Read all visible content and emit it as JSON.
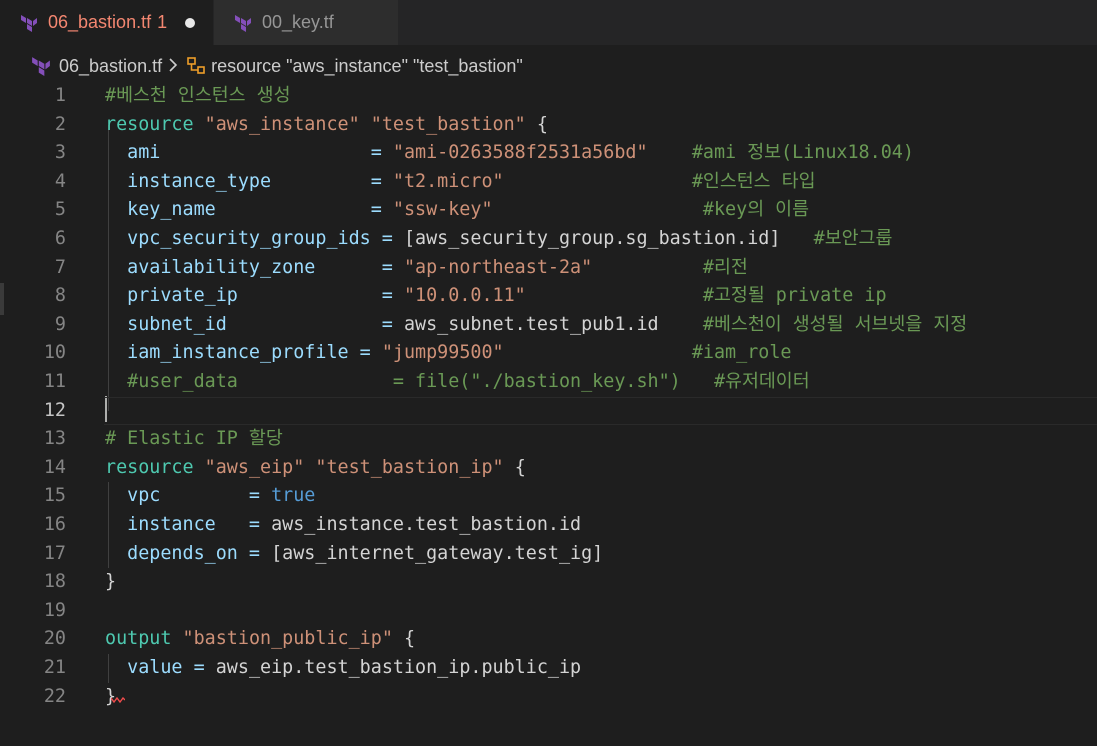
{
  "tabs": [
    {
      "label": "06_bastion.tf",
      "badge": "1",
      "modified": true,
      "active": true
    },
    {
      "label": "00_key.tf",
      "active": false
    }
  ],
  "breadcrumb": {
    "file": "06_bastion.tf",
    "symbol": "resource \"aws_instance\" \"test_bastion\""
  },
  "colors": {
    "accent_terraform": "#844fba",
    "active_tab_text": "#f48771",
    "symbol_icon": "#ee9d28"
  },
  "editor": {
    "current_line": 12,
    "lines": [
      {
        "n": "1",
        "parts": [
          {
            "t": "#베스천 인스턴스 생성",
            "c": "com"
          }
        ]
      },
      {
        "n": "2",
        "parts": [
          {
            "t": "resource ",
            "c": "res"
          },
          {
            "t": "\"aws_instance\"",
            "c": "str"
          },
          {
            "t": " ",
            "c": "plain"
          },
          {
            "t": "\"test_bastion\"",
            "c": "str"
          },
          {
            "t": " {",
            "c": "plain"
          }
        ]
      },
      {
        "n": "3",
        "parts": [
          {
            "t": "  ami                   = ",
            "c": "var"
          },
          {
            "t": "\"ami-0263588f2531a56bd\"",
            "c": "str"
          },
          {
            "t": "    ",
            "c": "plain"
          },
          {
            "t": "#ami 정보(Linux18.04)",
            "c": "com"
          }
        ]
      },
      {
        "n": "4",
        "parts": [
          {
            "t": "  instance_type         = ",
            "c": "var"
          },
          {
            "t": "\"t2.micro\"",
            "c": "str"
          },
          {
            "t": "                 ",
            "c": "plain"
          },
          {
            "t": "#인스턴스 타입",
            "c": "com"
          }
        ]
      },
      {
        "n": "5",
        "parts": [
          {
            "t": "  key_name              = ",
            "c": "var"
          },
          {
            "t": "\"ssw-key\"",
            "c": "str"
          },
          {
            "t": "                   ",
            "c": "plain"
          },
          {
            "t": "#key의 이름",
            "c": "com"
          }
        ]
      },
      {
        "n": "6",
        "parts": [
          {
            "t": "  vpc_security_group_ids = ",
            "c": "var"
          },
          {
            "t": "[aws_security_group.sg_bastion.id]",
            "c": "plain"
          },
          {
            "t": "   ",
            "c": "plain"
          },
          {
            "t": "#보안그룹",
            "c": "com"
          }
        ]
      },
      {
        "n": "7",
        "parts": [
          {
            "t": "  availability_zone      = ",
            "c": "var"
          },
          {
            "t": "\"ap-northeast-2a\"",
            "c": "str"
          },
          {
            "t": "          ",
            "c": "plain"
          },
          {
            "t": "#리전",
            "c": "com"
          }
        ]
      },
      {
        "n": "8",
        "parts": [
          {
            "t": "  private_ip             = ",
            "c": "var"
          },
          {
            "t": "\"10.0.0.11\"",
            "c": "str"
          },
          {
            "t": "                ",
            "c": "plain"
          },
          {
            "t": "#고정될 private ip",
            "c": "com"
          }
        ]
      },
      {
        "n": "9",
        "parts": [
          {
            "t": "  subnet_id              = ",
            "c": "var"
          },
          {
            "t": "aws_subnet.test_pub1.id",
            "c": "plain"
          },
          {
            "t": "    ",
            "c": "plain"
          },
          {
            "t": "#베스천이 생성될 서브넷을 지정",
            "c": "com"
          }
        ]
      },
      {
        "n": "10",
        "parts": [
          {
            "t": "  iam_instance_profile = ",
            "c": "var"
          },
          {
            "t": "\"jump99500\"",
            "c": "str"
          },
          {
            "t": "                 ",
            "c": "plain"
          },
          {
            "t": "#iam_role",
            "c": "com"
          }
        ]
      },
      {
        "n": "11",
        "parts": [
          {
            "t": "  #user_data              = file(\"./bastion_key.sh\")   #유저데이터",
            "c": "com"
          }
        ]
      },
      {
        "n": "12",
        "parts": []
      },
      {
        "n": "13",
        "parts": [
          {
            "t": "# Elastic IP 할당",
            "c": "com"
          }
        ]
      },
      {
        "n": "14",
        "parts": [
          {
            "t": "resource ",
            "c": "res"
          },
          {
            "t": "\"aws_eip\"",
            "c": "str"
          },
          {
            "t": " ",
            "c": "plain"
          },
          {
            "t": "\"test_bastion_ip\"",
            "c": "str"
          },
          {
            "t": " {",
            "c": "plain"
          }
        ]
      },
      {
        "n": "15",
        "parts": [
          {
            "t": "  vpc        = ",
            "c": "var"
          },
          {
            "t": "true",
            "c": "kw"
          }
        ]
      },
      {
        "n": "16",
        "parts": [
          {
            "t": "  instance   = ",
            "c": "var"
          },
          {
            "t": "aws_instance.test_bastion.id",
            "c": "plain"
          }
        ]
      },
      {
        "n": "17",
        "parts": [
          {
            "t": "  depends_on = ",
            "c": "var"
          },
          {
            "t": "[aws_internet_gateway.test_ig]",
            "c": "plain"
          }
        ]
      },
      {
        "n": "18",
        "parts": [
          {
            "t": "}",
            "c": "plain"
          }
        ]
      },
      {
        "n": "19",
        "parts": []
      },
      {
        "n": "20",
        "parts": [
          {
            "t": "output ",
            "c": "res"
          },
          {
            "t": "\"bastion_public_ip\"",
            "c": "str"
          },
          {
            "t": " {",
            "c": "plain"
          }
        ]
      },
      {
        "n": "21",
        "parts": [
          {
            "t": "  value = ",
            "c": "var"
          },
          {
            "t": "aws_eip.test_bastion_ip.public_ip",
            "c": "plain"
          }
        ]
      },
      {
        "n": "22",
        "parts": [
          {
            "t": "}",
            "c": "plain"
          }
        ]
      }
    ]
  }
}
